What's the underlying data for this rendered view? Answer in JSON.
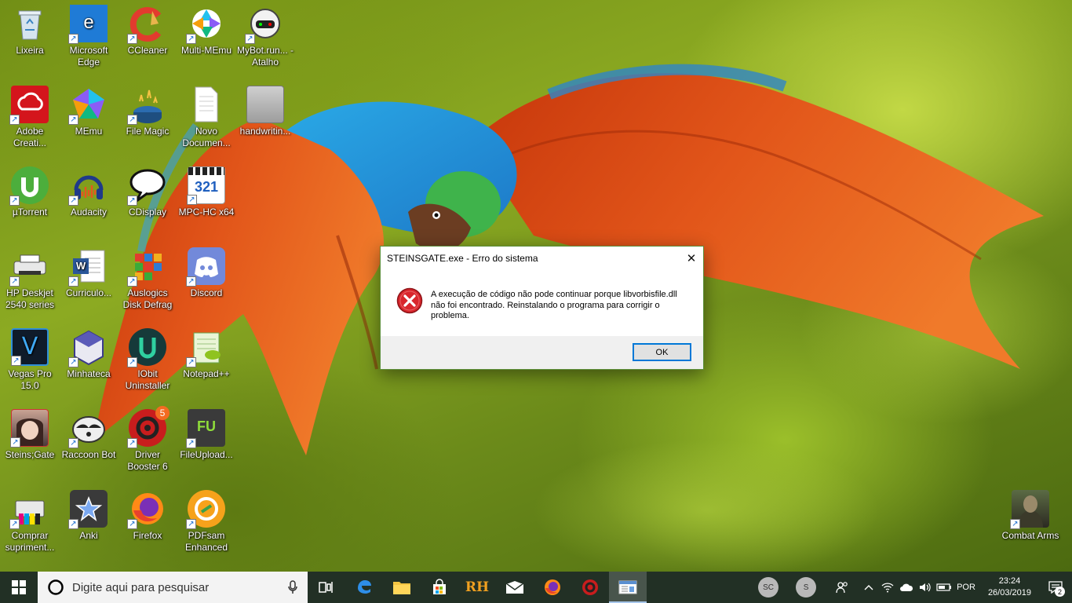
{
  "desktop": {
    "icons": [
      {
        "label": "Lixeira"
      },
      {
        "label": "Microsoft Edge"
      },
      {
        "label": "CCleaner"
      },
      {
        "label": "Multi-MEmu"
      },
      {
        "label": "MyBot.run... - Atalho"
      },
      {
        "label": "Adobe Creati..."
      },
      {
        "label": "MEmu"
      },
      {
        "label": "File Magic"
      },
      {
        "label": "Novo Documen..."
      },
      {
        "label": "handwritin..."
      },
      {
        "label": "µTorrent"
      },
      {
        "label": "Audacity"
      },
      {
        "label": "CDisplay"
      },
      {
        "label": "MPC-HC x64"
      },
      {
        "label": "HP Deskjet 2540 series"
      },
      {
        "label": "Curriculo..."
      },
      {
        "label": "Auslogics Disk Defrag"
      },
      {
        "label": "Discord"
      },
      {
        "label": "Vegas Pro 15.0"
      },
      {
        "label": "Minhateca"
      },
      {
        "label": "IObit Uninstaller"
      },
      {
        "label": "Notepad++"
      },
      {
        "label": "Steins;Gate"
      },
      {
        "label": "Raccoon Bot"
      },
      {
        "label": "Driver Booster 6"
      },
      {
        "label": "FileUpload..."
      },
      {
        "label": "Comprar supriment..."
      },
      {
        "label": "Anki"
      },
      {
        "label": "Firefox"
      },
      {
        "label": "PDFsam Enhanced"
      },
      {
        "label": "Combat Arms"
      }
    ],
    "icon_glyphs": {
      "mpc": "321",
      "vegas": "V",
      "word": "W",
      "driver_badge": "5",
      "fileupload": "FU",
      "edge": "e"
    }
  },
  "dialog": {
    "title": "STEINSGATE.exe - Erro do sistema",
    "close_glyph": "✕",
    "message": "A execução de código não pode continuar porque libvorbisfile.dll não foi encontrado. Reinstalando o programa para corrigir o problema.",
    "ok_label": "OK",
    "icon": "error-icon"
  },
  "taskbar": {
    "search_placeholder": "Digite aqui para pesquisar",
    "apps": [
      {
        "name": "task-view"
      },
      {
        "name": "edge"
      },
      {
        "name": "file-explorer"
      },
      {
        "name": "store"
      },
      {
        "name": "rh-app",
        "text": "RH"
      },
      {
        "name": "mail"
      },
      {
        "name": "firefox"
      },
      {
        "name": "driver-booster"
      },
      {
        "name": "steinsgate-window",
        "active": true
      }
    ],
    "tray": {
      "avatar1": "SC",
      "avatar2": "S",
      "language": "POR",
      "time": "23:24",
      "date": "26/03/2019",
      "notification_count": "2"
    }
  },
  "colors": {
    "taskbar_bg": "#223025",
    "dialog_border": "#5c8f3a",
    "ok_border": "#0078d7",
    "error_red": "#d9262c"
  }
}
